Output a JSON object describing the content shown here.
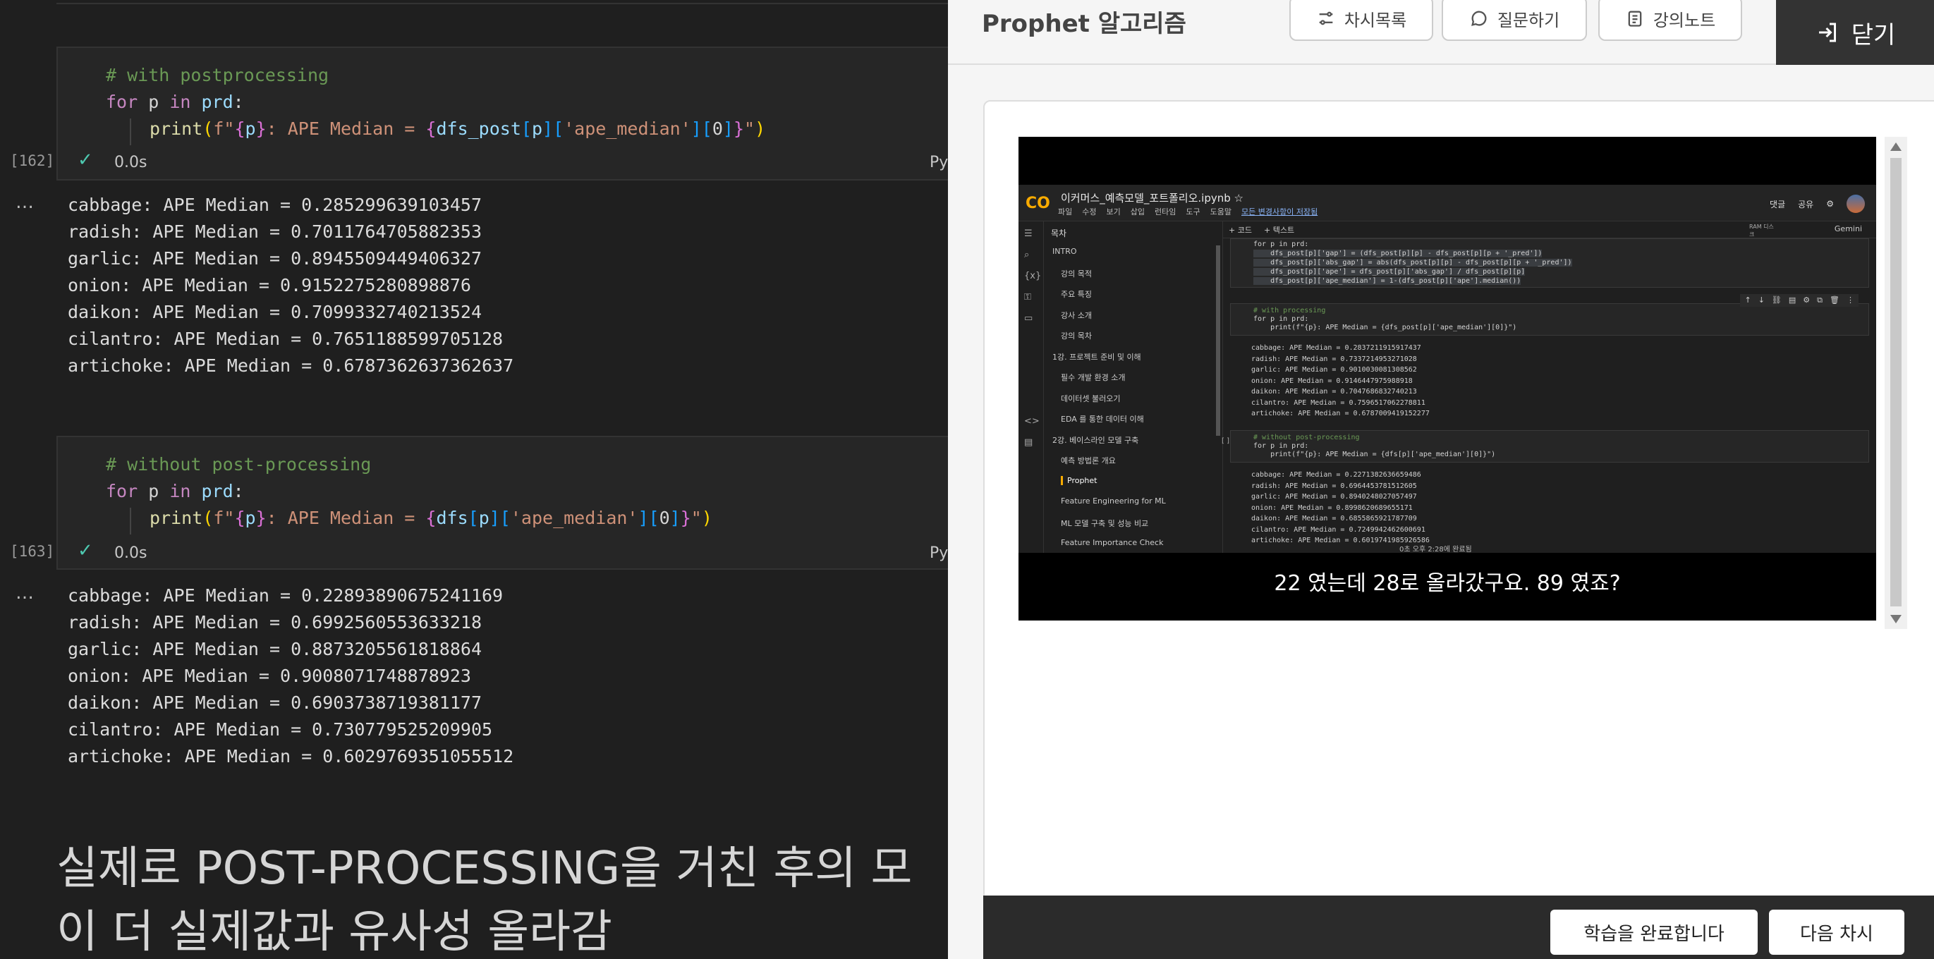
{
  "notebook": {
    "cell1": {
      "comment": "# with postprocessing",
      "line2": [
        "for",
        " ",
        "p",
        " ",
        "in",
        " ",
        "prd",
        ":"
      ],
      "exec_count": "[162]",
      "duration": "0.0s",
      "kernel": "Py"
    },
    "output1": [
      "cabbage: APE Median = 0.285299639103457",
      "radish: APE Median = 0.7011764705882353",
      "garlic: APE Median = 0.8945509449406327",
      "onion: APE Median = 0.9152275280898876",
      "daikon: APE Median = 0.7099332740213524",
      "cilantro: APE Median = 0.7651188599705128",
      "artichoke: APE Median = 0.6787362637362637"
    ],
    "cell2": {
      "comment": "# without post-processing",
      "exec_count": "[163]",
      "duration": "0.0s",
      "kernel": "Py"
    },
    "output2": [
      "cabbage: APE Median = 0.22893890675241169",
      "radish: APE Median = 0.6992560553633218",
      "garlic: APE Median = 0.8873205561818864",
      "onion: APE Median = 0.9008071748878923",
      "daikon: APE Median = 0.6903738719381177",
      "cilantro: APE Median = 0.730779525209905",
      "artichoke: APE Median = 0.6029769351055512"
    ],
    "ellipsis": "…",
    "markdown_line1": "실제로 POST-PROCESSING을 거친 후의 모",
    "markdown_line2": "이 더 실제값과 유사성 올라감"
  },
  "player": {
    "title": "Prophet 알고리즘",
    "buttons": {
      "toc": "차시목록",
      "question": "질문하기",
      "notes": "강의노트",
      "close": "닫기"
    },
    "subtitle": "22 였는데 28로 올라갔구요. 89 였죠?",
    "footer": {
      "complete": "학습을 완료합니다",
      "next": "다음 차시"
    }
  },
  "colab": {
    "logo": "CO",
    "filename": "이커머스_예측모델_포트폴리오.ipynb ☆",
    "menu": [
      "파일",
      "수정",
      "보기",
      "삽입",
      "런타임",
      "도구",
      "도움말"
    ],
    "saved": "모든 변경사항이 저장됨",
    "header_right": [
      "댓글",
      "공유"
    ],
    "toolbar": [
      "+ 코드",
      "+ 텍스트"
    ],
    "ram_label": "RAM 디스크",
    "gemini": "Gemini",
    "toc_title": "목차",
    "toc": [
      "INTRO",
      "강의 목적",
      "주요 특징",
      "강사 소개",
      "강의 목차",
      "1강. 프로젝트 준비 및 이해",
      "필수 개발 환경 소개",
      "데이터셋 불러오기",
      "EDA 를 통한 데이터 이해",
      "2강. 베이스라인 모델 구축",
      "예측 방법론 개요",
      "Prophet",
      "Feature Engineering for ML",
      "ML 모델 구축 및 성능 비교",
      "Feature Importance Check"
    ],
    "code_top": [
      "for p in prd:",
      "    dfs_post[p]['gap'] = (dfs_post[p][p] - dfs_post[p][p + '_pred'])",
      "    dfs_post[p]['abs_gap'] = abs(dfs_post[p][p] - dfs_post[p][p + '_pred'])",
      "    dfs_post[p]['ape'] = dfs_post[p]['abs_gap'] / dfs_post[p][p]",
      "    dfs_post[p]['ape_median'] = 1-(dfs_post[p]['ape'].median())"
    ],
    "code_with": [
      "# with processing",
      "for p in prd:",
      "    print(f\"{p}: APE Median = {dfs_post[p]['ape_median'][0]}\")"
    ],
    "out_with": [
      "cabbage: APE Median = 0.2837211915917437",
      "radish: APE Median = 0.7337214953271028",
      "garlic: APE Median = 0.9010030081308562",
      "onion: APE Median = 0.9146447975988918",
      "daikon: APE Median = 0.7047686832740213",
      "cilantro: APE Median = 0.7596517062278811",
      "artichoke: APE Median = 0.6787009419152277"
    ],
    "code_without": [
      "# without post-processing",
      "for p in prd:",
      "    print(f\"{p}: APE Median = {dfs[p]['ape_median'][0]}\")"
    ],
    "out_without": [
      "cabbage: APE Median = 0.2271382636659486",
      "radish: APE Median = 0.6964453781512605",
      "garlic: APE Median = 0.8940248027057497",
      "onion: APE Median = 0.8998620689655171",
      "daikon: APE Median = 0.6855865921787709",
      "cilantro: APE Median = 0.7249942462600691",
      "artichoke: APE Median = 0.6019741985926586"
    ],
    "empty_exec": "[ ]",
    "status": "0초   오후 2:28에 완료됨"
  }
}
